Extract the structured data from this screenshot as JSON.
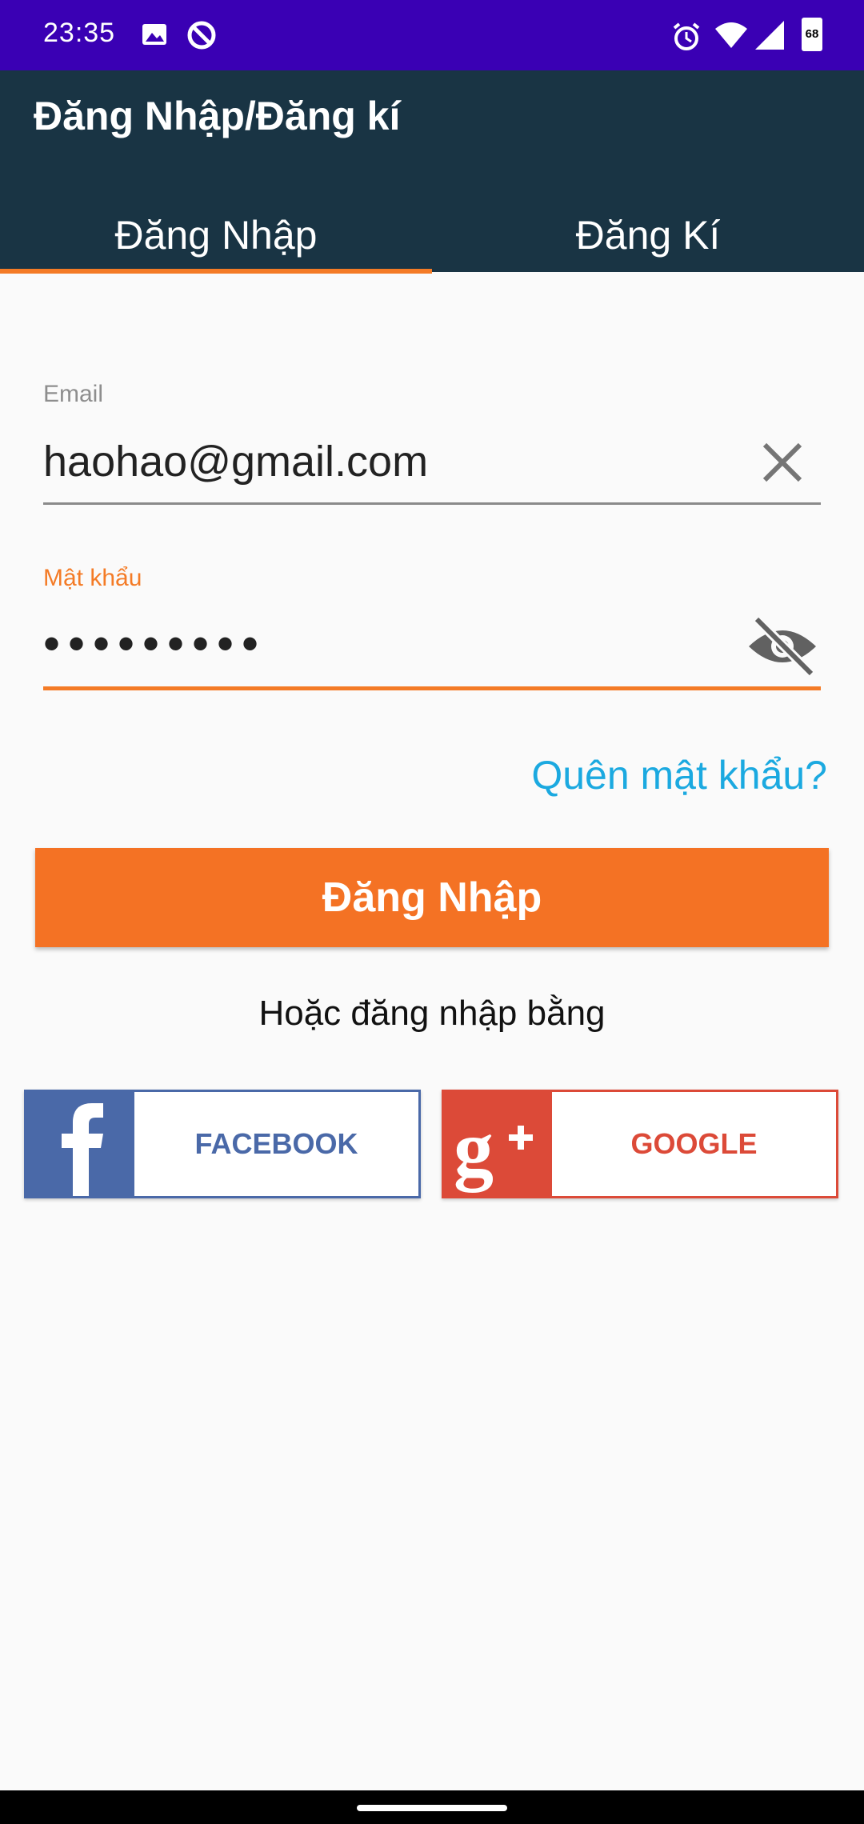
{
  "status_bar": {
    "time": "23:35",
    "battery_level": "68",
    "icons": [
      "image-icon",
      "sync-icon",
      "alarm-icon",
      "wifi-icon",
      "signal-icon",
      "battery-icon"
    ]
  },
  "appbar": {
    "title": "Đăng Nhập/Đăng kí"
  },
  "tabs": [
    {
      "label": "Đăng Nhập",
      "selected": true
    },
    {
      "label": "Đăng Kí",
      "selected": false
    }
  ],
  "form": {
    "email_label": "Email",
    "email_value": "haohao@gmail.com",
    "password_label": "Mật khẩu",
    "password_value": "•••••••••",
    "forgot_password": "Quên mật khẩu?",
    "login_button": "Đăng Nhập",
    "or_text": "Hoặc đăng nhập bằng"
  },
  "social": {
    "facebook_label": "FACEBOOK",
    "google_label": "GOOGLE"
  },
  "colors": {
    "status_bar": "#3A00B4",
    "appbar": "#193444",
    "accent": "#F47224",
    "link": "#1BA9E0",
    "facebook": "#4A69A8",
    "google": "#DC4A38"
  }
}
